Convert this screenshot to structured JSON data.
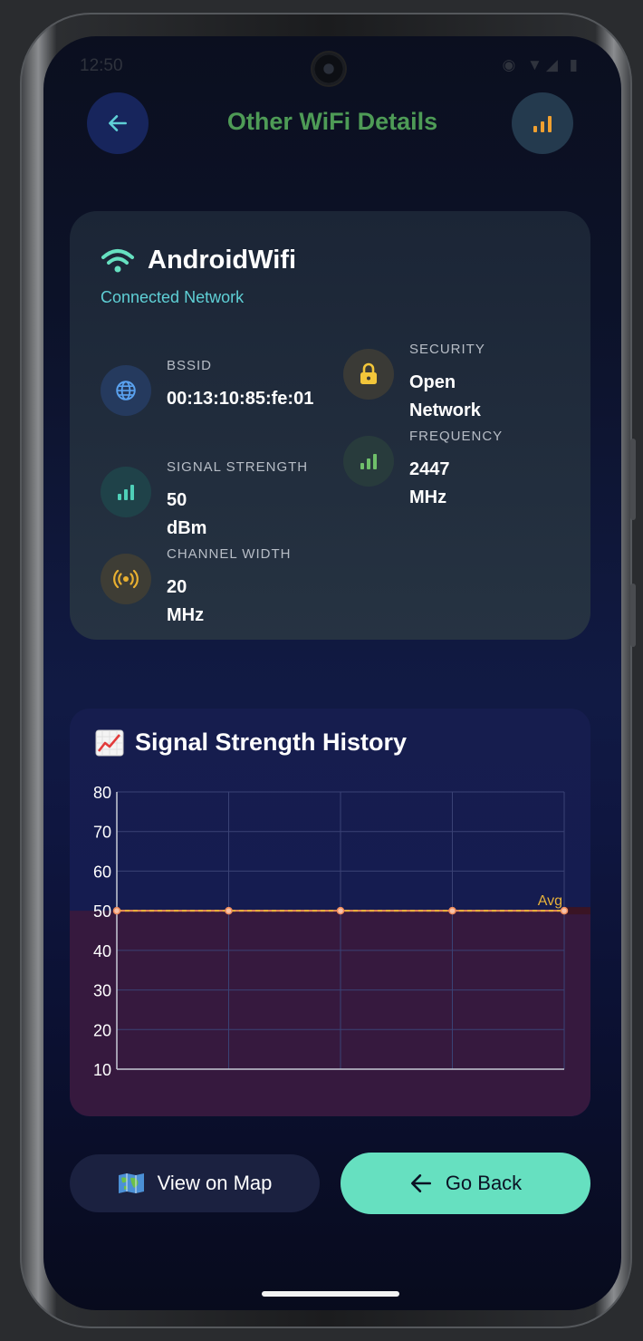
{
  "status_bar": {
    "time": "12:50",
    "icons": "◉ ▼◢ ▮"
  },
  "header": {
    "title": "Other WiFi Details",
    "back_icon": "arrow-left-icon",
    "signal_icon": "signal-bars-icon"
  },
  "network": {
    "ssid": "AndroidWifi",
    "status": "Connected Network",
    "details": {
      "bssid": {
        "label": "BSSID",
        "value": "00:13:10:85:fe:01"
      },
      "security": {
        "label": "SECURITY",
        "value": "Open Network"
      },
      "frequency": {
        "label": "FREQUENCY",
        "value": "2447 MHz"
      },
      "signal_strength": {
        "label": "SIGNAL STRENGTH",
        "value": "50 dBm"
      },
      "channel_width": {
        "label": "CHANNEL WIDTH",
        "value": "20 MHz"
      }
    }
  },
  "chart": {
    "title": "Signal Strength History",
    "title_icon": "chart-increasing-emoji"
  },
  "chart_data": {
    "type": "line",
    "title": "Signal Strength History",
    "x": [
      1,
      2,
      3,
      4,
      5
    ],
    "series": [
      {
        "values": [
          50,
          50,
          50,
          50,
          50
        ]
      }
    ],
    "average": {
      "label": "Avg",
      "value": 50
    },
    "ylim": [
      10,
      80
    ],
    "yticks": [
      80,
      70,
      60,
      50,
      40,
      30,
      20,
      10
    ],
    "grid": true,
    "colors": {
      "line": "#f08c5a",
      "avg_line": "#e8b23a",
      "fill": "#3a1a3c",
      "grid": "#3a4275"
    }
  },
  "actions": {
    "view_map": {
      "label": "View on Map",
      "icon": "world-map-emoji"
    },
    "go_back": {
      "label": "Go Back",
      "icon": "arrow-left-icon"
    }
  },
  "colors": {
    "accent": "#66e0c0",
    "title_green": "#4e9b56",
    "cyan": "#5fd0d6",
    "lock_yellow": "#f3c63a",
    "signal_orange": "#f0a030"
  }
}
